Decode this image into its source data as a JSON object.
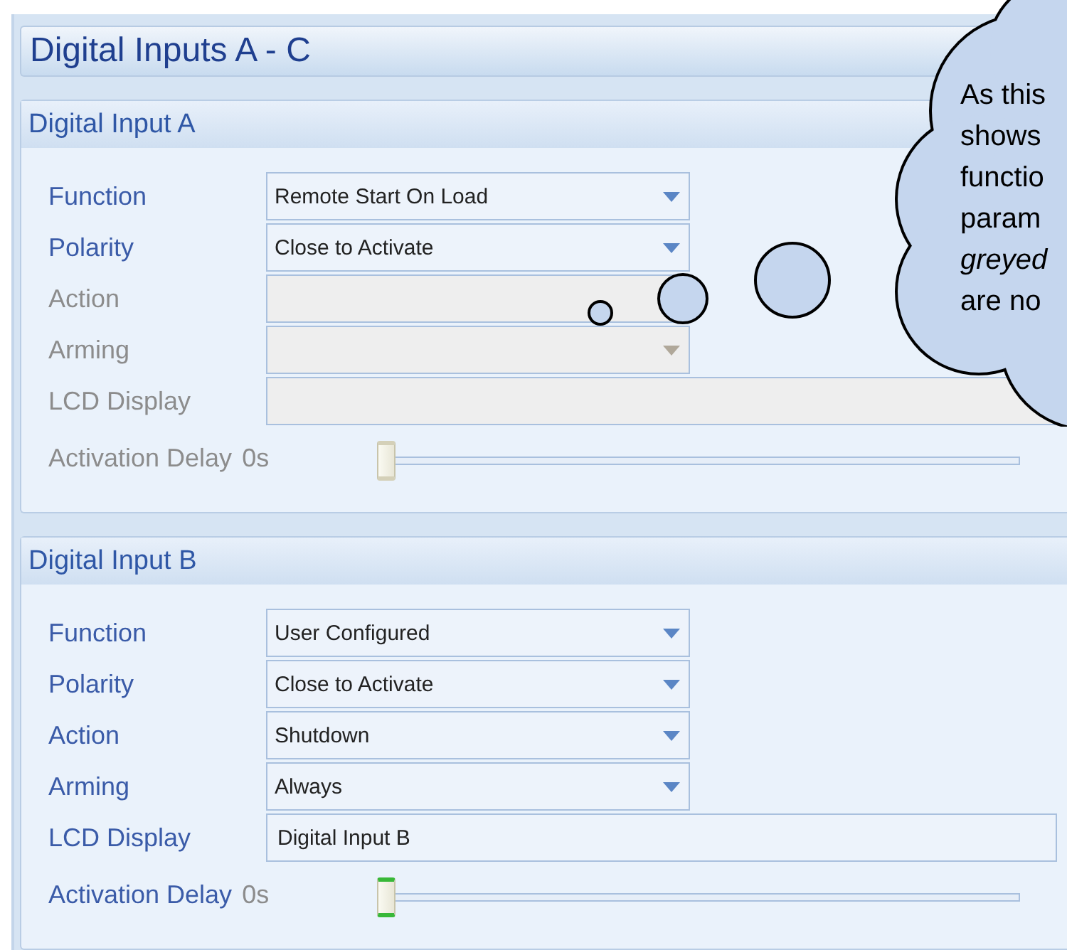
{
  "page": {
    "title": "Digital Inputs A - C"
  },
  "panels": [
    {
      "title": "Digital Input A",
      "fields": [
        {
          "kind": "dropdown",
          "label": "Function",
          "value": "Remote Start On Load",
          "disabled": false
        },
        {
          "kind": "dropdown",
          "label": "Polarity",
          "value": "Close to Activate",
          "disabled": false
        },
        {
          "kind": "dropdown",
          "label": "Action",
          "disabled": true
        },
        {
          "kind": "dropdown",
          "label": "Arming",
          "disabled": true
        },
        {
          "kind": "text",
          "label": "LCD Display",
          "disabled": true
        },
        {
          "kind": "slider",
          "label": "Activation Delay",
          "reading": "0s",
          "level": 0,
          "disabled": true
        }
      ]
    },
    {
      "title": "Digital Input B",
      "fields": [
        {
          "kind": "dropdown",
          "label": "Function",
          "value": "User Configured",
          "disabled": false
        },
        {
          "kind": "dropdown",
          "label": "Polarity",
          "value": "Close to Activate",
          "disabled": false
        },
        {
          "kind": "dropdown",
          "label": "Action",
          "value": "Shutdown",
          "disabled": false
        },
        {
          "kind": "dropdown",
          "label": "Arming",
          "value": "Always",
          "disabled": false
        },
        {
          "kind": "text",
          "label": "LCD Display",
          "value": "Digital Input B",
          "disabled": false
        },
        {
          "kind": "slider",
          "label": "Activation Delay",
          "reading": "0s",
          "level": 0,
          "disabled": false
        }
      ]
    }
  ],
  "callout": {
    "lines": [
      {
        "text": "As this",
        "italic": false
      },
      {
        "text": "shows",
        "italic": false
      },
      {
        "text": "functio",
        "italic": false
      },
      {
        "text": "param",
        "italic": false
      },
      {
        "text": "greyed",
        "italic": true
      },
      {
        "text": "are no",
        "italic": false
      }
    ]
  }
}
